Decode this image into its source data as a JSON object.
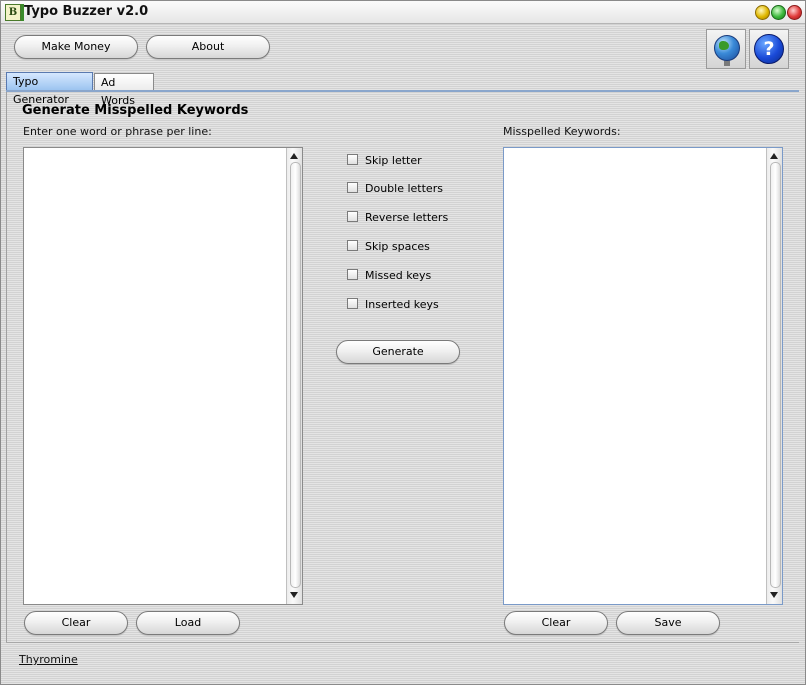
{
  "window": {
    "title": "Typo Buzzer v2.0",
    "app_icon_letter": "B"
  },
  "toolbar": {
    "make_money_label": "Make Money",
    "about_label": "About",
    "help_glyph": "?",
    "web_icon": "globe-icon",
    "help_icon": "help-icon"
  },
  "tabs": [
    {
      "label": "Typo Generator",
      "active": true
    },
    {
      "label": "Ad Words",
      "active": false
    }
  ],
  "main": {
    "section_title": "Generate Misspelled Keywords",
    "input_label": "Enter one word or phrase per line:",
    "input_value": "",
    "output_label": "Misspelled Keywords:",
    "output_value": "",
    "options": [
      {
        "label": "Skip letter",
        "checked": false
      },
      {
        "label": "Double letters",
        "checked": false
      },
      {
        "label": "Reverse letters",
        "checked": false
      },
      {
        "label": "Skip spaces",
        "checked": false
      },
      {
        "label": "Missed keys",
        "checked": false
      },
      {
        "label": "Inserted keys",
        "checked": false
      }
    ],
    "generate_label": "Generate",
    "input_clear_label": "Clear",
    "load_label": "Load",
    "output_clear_label": "Clear",
    "save_label": "Save"
  },
  "footer": {
    "link": "Thyromine"
  }
}
